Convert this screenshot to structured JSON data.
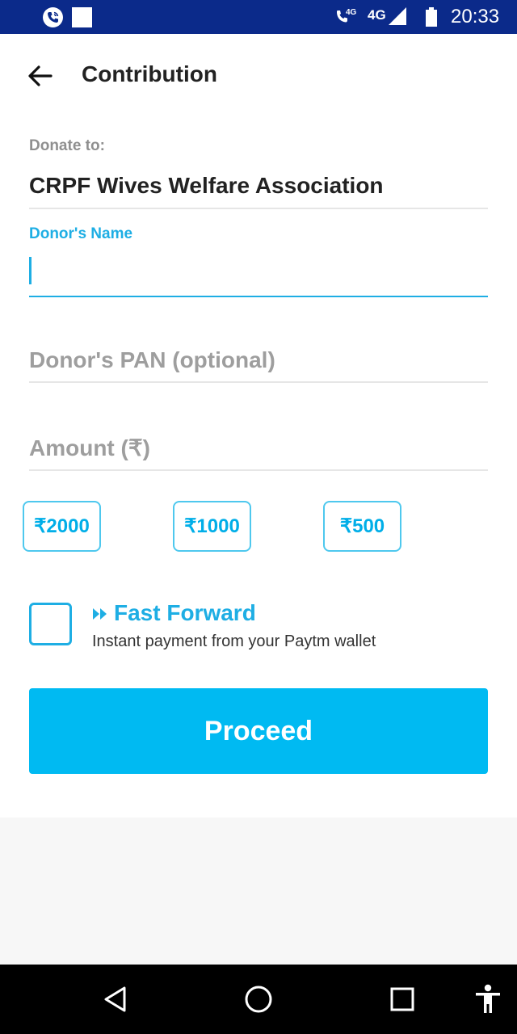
{
  "status_bar": {
    "network_label": "4G",
    "volte_label": "4G",
    "time": "20:33"
  },
  "header": {
    "title": "Contribution"
  },
  "form": {
    "donate_to_label": "Donate to:",
    "donate_to_value": "CRPF Wives Welfare Association",
    "donor_name_label": "Donor's Name",
    "donor_name_value": "",
    "donor_pan_placeholder": "Donor's PAN (optional)",
    "amount_placeholder": "Amount (₹)"
  },
  "quick_amounts": [
    "₹2000",
    "₹1000",
    "₹500"
  ],
  "fast_forward": {
    "checked": false,
    "title": "Fast Forward",
    "subtitle": "Instant payment from your Paytm wallet"
  },
  "proceed_label": "Proceed",
  "colors": {
    "status_bar": "#0b2a8a",
    "accent": "#1eaee4",
    "proceed_button": "#00baf2",
    "nav_bar": "#000000"
  },
  "icons": {
    "status": [
      "wifi-call-icon",
      "notification-square-icon",
      "volte-call-icon",
      "signal-icon",
      "battery-icon"
    ],
    "header": "back-arrow-icon",
    "fast_forward": "fast-forward-icon",
    "navigation": [
      "nav-back-icon",
      "nav-home-icon",
      "nav-recents-icon",
      "accessibility-icon"
    ]
  }
}
